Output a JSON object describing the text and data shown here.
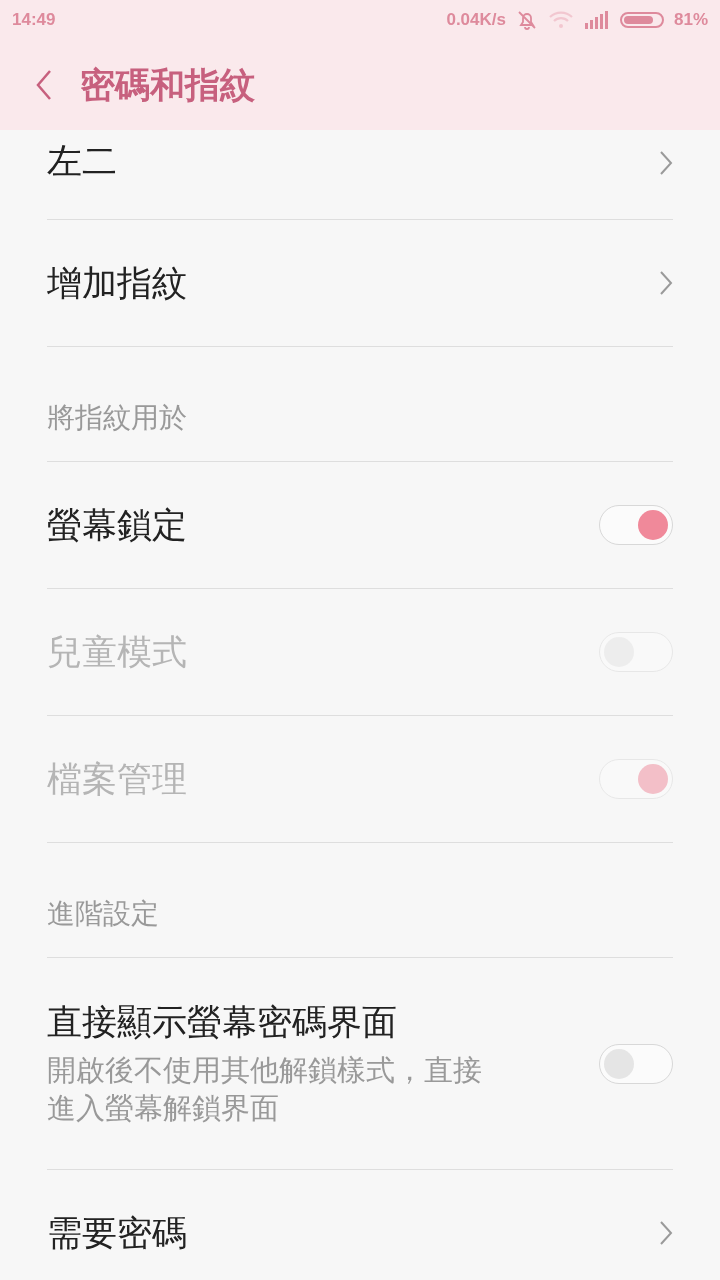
{
  "status_bar": {
    "time": "14:49",
    "speed": "0.04K/s",
    "battery": "81%"
  },
  "header": {
    "title": "密碼和指紋"
  },
  "items": [
    {
      "kind": "nav",
      "title": "左二",
      "partial": true
    },
    {
      "kind": "nav",
      "title": "增加指紋",
      "partial": false
    },
    {
      "kind": "section",
      "title": "將指紋用於"
    },
    {
      "kind": "toggle",
      "title": "螢幕鎖定",
      "on": true,
      "disabled": false
    },
    {
      "kind": "toggle",
      "title": "兒童模式",
      "on": false,
      "disabled": true
    },
    {
      "kind": "toggle",
      "title": "檔案管理",
      "on": true,
      "disabled": true
    },
    {
      "kind": "section",
      "title": "進階設定"
    },
    {
      "kind": "toggle",
      "title": "直接顯示螢幕密碼界面",
      "subtitle": "開啟後不使用其他解鎖樣式，直接進入螢幕解鎖界面",
      "on": false,
      "disabled": false
    },
    {
      "kind": "nav",
      "title": "需要密碼",
      "partial": false
    }
  ]
}
